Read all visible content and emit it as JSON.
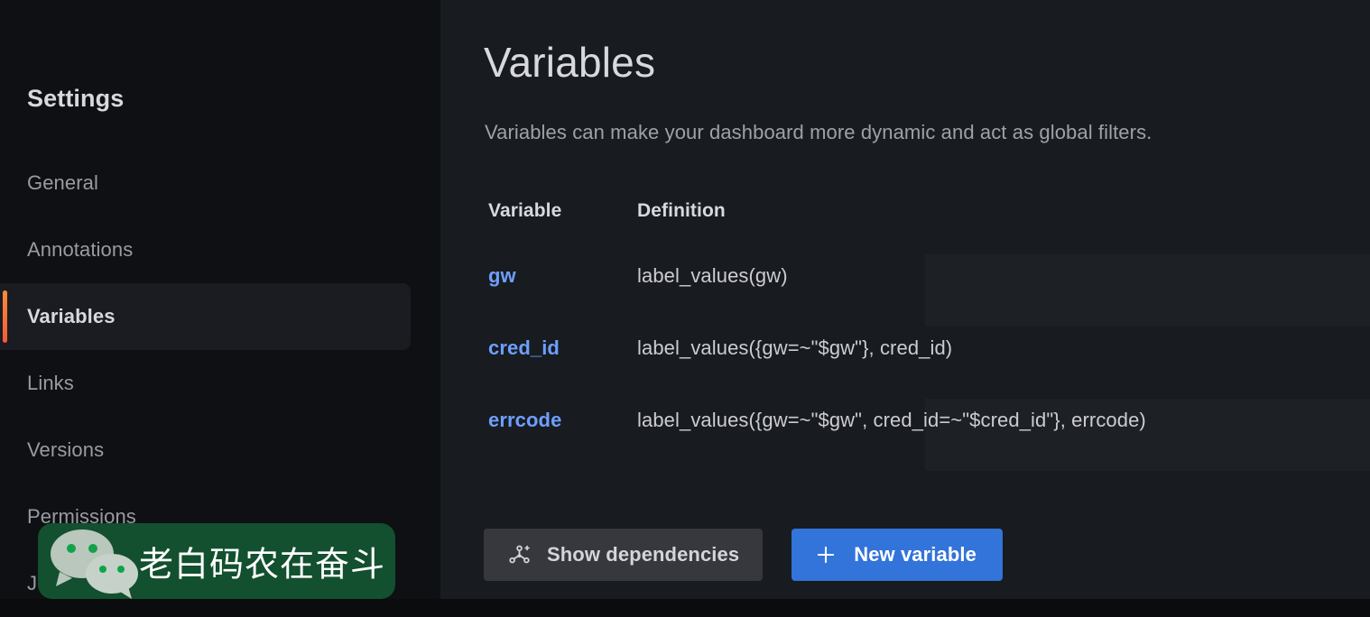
{
  "sidebar": {
    "title": "Settings",
    "items": [
      {
        "label": "General",
        "selected": false
      },
      {
        "label": "Annotations",
        "selected": false
      },
      {
        "label": "Variables",
        "selected": true
      },
      {
        "label": "Links",
        "selected": false
      },
      {
        "label": "Versions",
        "selected": false
      },
      {
        "label": "Permissions",
        "selected": false
      },
      {
        "label": "JSON Model",
        "selected": false
      }
    ],
    "selected_indicator_color": "#f25b36"
  },
  "main": {
    "title": "Variables",
    "description": "Variables can make your dashboard more dynamic and act as global filters.",
    "table": {
      "columns": [
        "Variable",
        "Definition"
      ],
      "rows": [
        {
          "variable": "gw",
          "definition": "label_values(gw)"
        },
        {
          "variable": "cred_id",
          "definition": "label_values({gw=~\"$gw\"}, cred_id)"
        },
        {
          "variable": "errcode",
          "definition": "label_values({gw=~\"$gw\", cred_id=~\"$cred_id\"}, errcode)"
        }
      ],
      "link_color": "#6e9fff"
    },
    "actions": {
      "show_dependencies_label": "Show dependencies",
      "show_dependencies_icon": "graph-nodes-icon",
      "new_variable_label": "New variable",
      "new_variable_icon": "plus-icon",
      "primary_color": "#3274d9"
    }
  },
  "watermark": {
    "text": "老白码农在奋斗",
    "icon": "wechat-logo-icon",
    "background_color": "#12502f"
  }
}
